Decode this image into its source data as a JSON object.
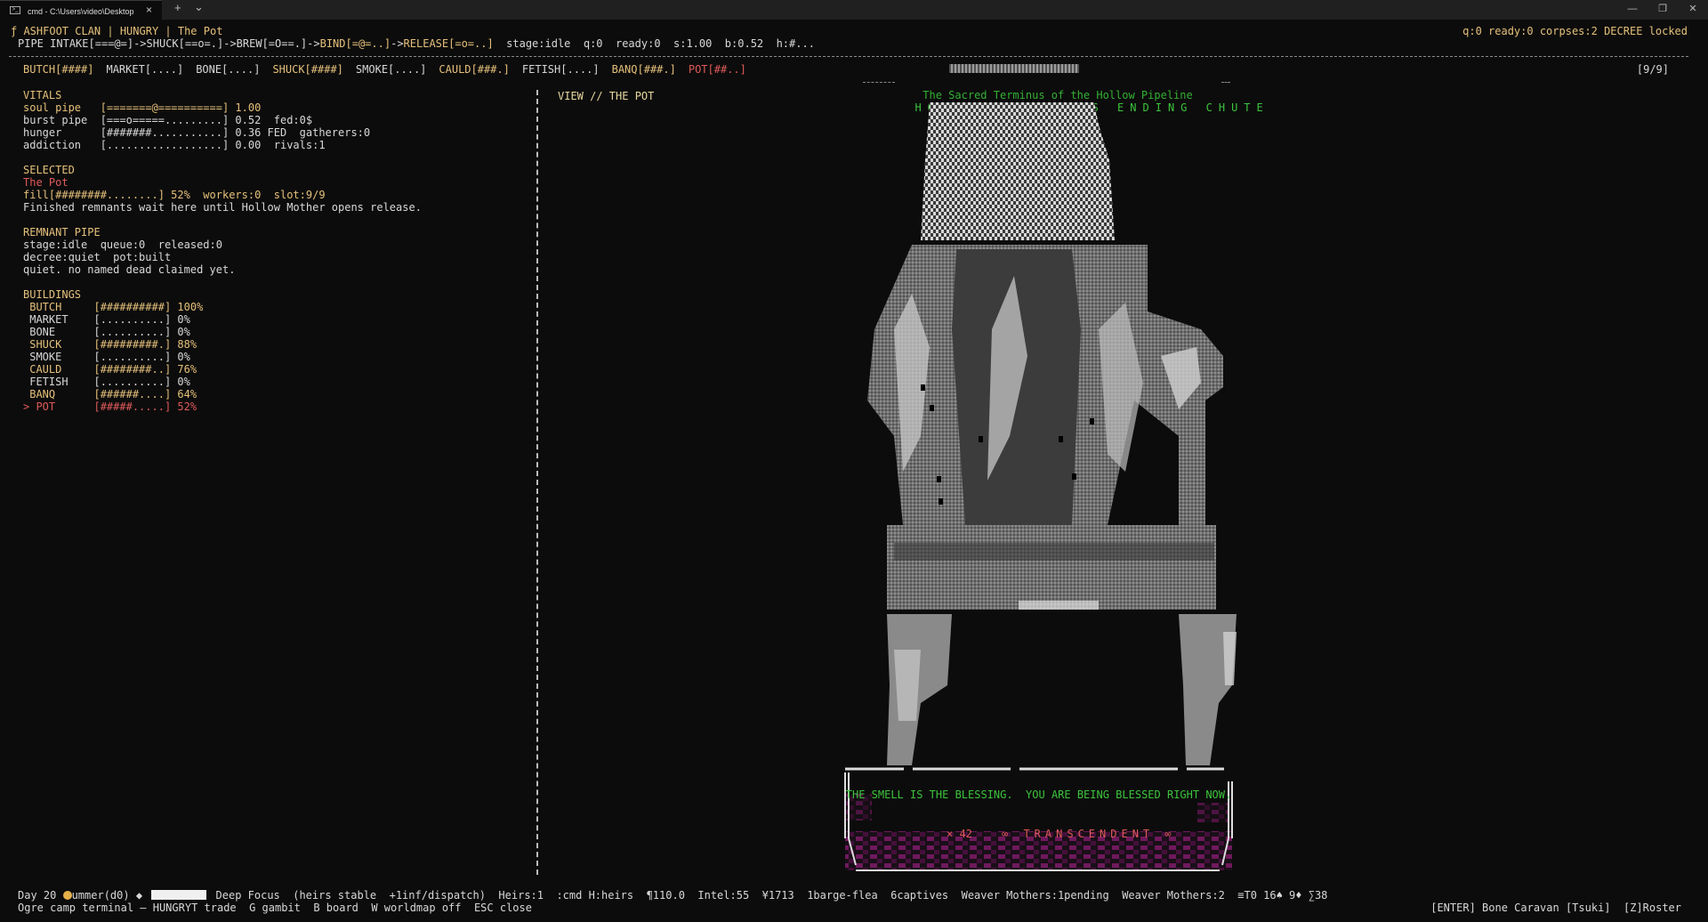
{
  "window": {
    "tab_title": "cmd - C:\\Users\\video\\Desktop",
    "new_tab": "+",
    "tab_menu": "⌄",
    "controls": [
      "—",
      "❐",
      "✕"
    ]
  },
  "header": {
    "clan_line": "ƒ ASHFOOT CLAN | HUNGRY | The Pot",
    "pipe_label": "PIPE",
    "pipe_stages": [
      {
        "text": "INTAKE[===@=]",
        "color": "w"
      },
      {
        "text": "->",
        "color": "w"
      },
      {
        "text": "SHUCK[==o=.]",
        "color": "w"
      },
      {
        "text": "->",
        "color": "w"
      },
      {
        "text": "BREW[=O==.]",
        "color": "w"
      },
      {
        "text": "->",
        "color": "w"
      },
      {
        "text": "BIND[=@=..]",
        "color": "y"
      },
      {
        "text": "->",
        "color": "w"
      },
      {
        "text": "RELEASE[=o=..]",
        "color": "y"
      }
    ],
    "pipe_stats": "  stage:idle  q:0  ready:0  s:1.00  b:0.52  h:#...",
    "right_status": "q:0 ready:0 corpses:2 DECREE locked"
  },
  "building_strip": [
    {
      "text": "BUTCH[####]",
      "color": "y"
    },
    {
      "text": "MARKET[....]",
      "color": "w"
    },
    {
      "text": "BONE[....]",
      "color": "w"
    },
    {
      "text": "SHUCK[####]",
      "color": "y"
    },
    {
      "text": "SMOKE[....]",
      "color": "w"
    },
    {
      "text": "CAULD[###.]",
      "color": "y"
    },
    {
      "text": "FETISH[....]",
      "color": "w"
    },
    {
      "text": "BANQ[###.]",
      "color": "y"
    },
    {
      "text": "POT[##..]",
      "color": "r"
    }
  ],
  "slot_count": "[9/9]",
  "scene_title": "HOLLOW MOTHER'S ENDING CHUTE",
  "scene_subtitle": "The Sacred Terminus of the Hollow Pipeline",
  "view_label": "VIEW // THE POT",
  "vitals": {
    "heading": "VITALS",
    "rows": [
      {
        "text": "soul pipe   [=======@==========] 1.00",
        "color": "y"
      },
      {
        "text": "burst pipe  [===o=====.........] 0.52  fed:0$",
        "color": "w"
      },
      {
        "text": "hunger      [#######...........] 0.36 FED  gatherers:0",
        "color": "w"
      },
      {
        "text": "addiction   [..................] 0.00  rivals:1",
        "color": "w"
      }
    ]
  },
  "selected": {
    "heading": "SELECTED",
    "name": "The Pot",
    "fill_line": "fill[########........] 52%  workers:0  slot:9/9",
    "note": "Finished remnants wait here until Hollow Mother opens release."
  },
  "remnant_pipe": {
    "heading": "REMNANT PIPE",
    "rows": [
      "stage:idle  queue:0  released:0",
      "decree:quiet  pot:built",
      "quiet. no named dead claimed yet."
    ]
  },
  "buildings": {
    "heading": "BUILDINGS",
    "items": [
      {
        "text": " BUTCH     [##########] 100%",
        "color": "y"
      },
      {
        "text": " MARKET    [..........] 0%",
        "color": "w"
      },
      {
        "text": " BONE      [..........] 0%",
        "color": "w"
      },
      {
        "text": " SHUCK     [#########.] 88%",
        "color": "y"
      },
      {
        "text": " SMOKE     [..........] 0%",
        "color": "w"
      },
      {
        "text": " CAULD     [########..] 76%",
        "color": "y"
      },
      {
        "text": " FETISH    [..........] 0%",
        "color": "w"
      },
      {
        "text": " BANQ      [######....] 64%",
        "color": "y"
      },
      {
        "text": "> POT      [#####.....] 52%",
        "color": "r"
      }
    ]
  },
  "dialog": {
    "message": "THE SMELL IS THE BLESSING.  YOU ARE BEING BLESSED RIGHT NOW.",
    "count": "× 42",
    "status": "∞ TRANSCENDENT ∞"
  },
  "footer": {
    "day": "Day 20 ",
    "season": "ummer(d0)",
    "diamond": " ◆ ",
    "focus": "Deep Focus",
    "line1_rest": "  (heirs stable  +1inf/dispatch)  Heirs:1  :cmd H:heirs  ¶110.0  Intel:55  ¥1713  1barge-flea  6captives  Weaver Mothers:1pending  Weaver Mothers:2  ≡T0 16♠ 9♦ ∑38",
    "line2": "Ogre camp terminal — HUNGRYT trade  G gambit  B board  W worldmap off  ESC close",
    "right": "[ENTER] Bone Caravan [Tsuki]  [Z]Roster"
  },
  "colors": {
    "background": "#0c0c0c",
    "text": "#cccccc",
    "yellow": "#e5c07b",
    "red": "#e05a5a",
    "green": "#3cc43c",
    "magenta": "#b0208f"
  },
  "icons": [
    "terminal-icon",
    "close-icon",
    "sun-icon",
    "diamond-icon"
  ]
}
